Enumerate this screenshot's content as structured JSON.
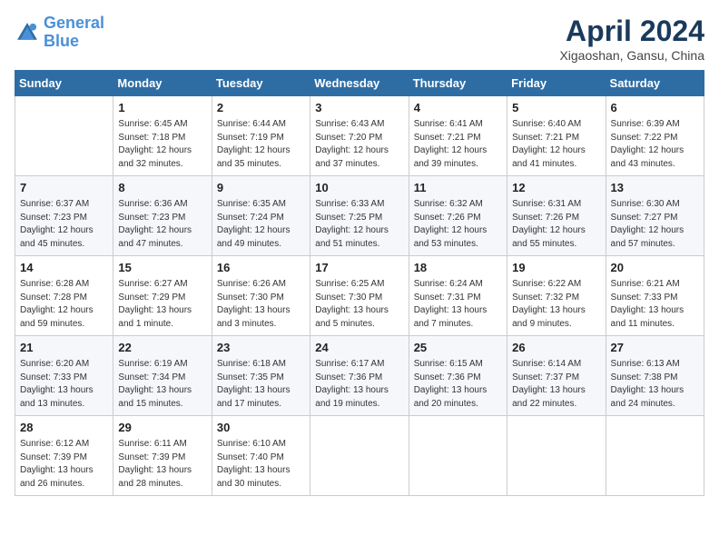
{
  "logo": {
    "line1": "General",
    "line2": "Blue"
  },
  "title": "April 2024",
  "location": "Xigaoshan, Gansu, China",
  "days_header": [
    "Sunday",
    "Monday",
    "Tuesday",
    "Wednesday",
    "Thursday",
    "Friday",
    "Saturday"
  ],
  "weeks": [
    [
      {
        "num": "",
        "sunrise": "",
        "sunset": "",
        "daylight": ""
      },
      {
        "num": "1",
        "sunrise": "Sunrise: 6:45 AM",
        "sunset": "Sunset: 7:18 PM",
        "daylight": "Daylight: 12 hours and 32 minutes."
      },
      {
        "num": "2",
        "sunrise": "Sunrise: 6:44 AM",
        "sunset": "Sunset: 7:19 PM",
        "daylight": "Daylight: 12 hours and 35 minutes."
      },
      {
        "num": "3",
        "sunrise": "Sunrise: 6:43 AM",
        "sunset": "Sunset: 7:20 PM",
        "daylight": "Daylight: 12 hours and 37 minutes."
      },
      {
        "num": "4",
        "sunrise": "Sunrise: 6:41 AM",
        "sunset": "Sunset: 7:21 PM",
        "daylight": "Daylight: 12 hours and 39 minutes."
      },
      {
        "num": "5",
        "sunrise": "Sunrise: 6:40 AM",
        "sunset": "Sunset: 7:21 PM",
        "daylight": "Daylight: 12 hours and 41 minutes."
      },
      {
        "num": "6",
        "sunrise": "Sunrise: 6:39 AM",
        "sunset": "Sunset: 7:22 PM",
        "daylight": "Daylight: 12 hours and 43 minutes."
      }
    ],
    [
      {
        "num": "7",
        "sunrise": "Sunrise: 6:37 AM",
        "sunset": "Sunset: 7:23 PM",
        "daylight": "Daylight: 12 hours and 45 minutes."
      },
      {
        "num": "8",
        "sunrise": "Sunrise: 6:36 AM",
        "sunset": "Sunset: 7:23 PM",
        "daylight": "Daylight: 12 hours and 47 minutes."
      },
      {
        "num": "9",
        "sunrise": "Sunrise: 6:35 AM",
        "sunset": "Sunset: 7:24 PM",
        "daylight": "Daylight: 12 hours and 49 minutes."
      },
      {
        "num": "10",
        "sunrise": "Sunrise: 6:33 AM",
        "sunset": "Sunset: 7:25 PM",
        "daylight": "Daylight: 12 hours and 51 minutes."
      },
      {
        "num": "11",
        "sunrise": "Sunrise: 6:32 AM",
        "sunset": "Sunset: 7:26 PM",
        "daylight": "Daylight: 12 hours and 53 minutes."
      },
      {
        "num": "12",
        "sunrise": "Sunrise: 6:31 AM",
        "sunset": "Sunset: 7:26 PM",
        "daylight": "Daylight: 12 hours and 55 minutes."
      },
      {
        "num": "13",
        "sunrise": "Sunrise: 6:30 AM",
        "sunset": "Sunset: 7:27 PM",
        "daylight": "Daylight: 12 hours and 57 minutes."
      }
    ],
    [
      {
        "num": "14",
        "sunrise": "Sunrise: 6:28 AM",
        "sunset": "Sunset: 7:28 PM",
        "daylight": "Daylight: 12 hours and 59 minutes."
      },
      {
        "num": "15",
        "sunrise": "Sunrise: 6:27 AM",
        "sunset": "Sunset: 7:29 PM",
        "daylight": "Daylight: 13 hours and 1 minute."
      },
      {
        "num": "16",
        "sunrise": "Sunrise: 6:26 AM",
        "sunset": "Sunset: 7:30 PM",
        "daylight": "Daylight: 13 hours and 3 minutes."
      },
      {
        "num": "17",
        "sunrise": "Sunrise: 6:25 AM",
        "sunset": "Sunset: 7:30 PM",
        "daylight": "Daylight: 13 hours and 5 minutes."
      },
      {
        "num": "18",
        "sunrise": "Sunrise: 6:24 AM",
        "sunset": "Sunset: 7:31 PM",
        "daylight": "Daylight: 13 hours and 7 minutes."
      },
      {
        "num": "19",
        "sunrise": "Sunrise: 6:22 AM",
        "sunset": "Sunset: 7:32 PM",
        "daylight": "Daylight: 13 hours and 9 minutes."
      },
      {
        "num": "20",
        "sunrise": "Sunrise: 6:21 AM",
        "sunset": "Sunset: 7:33 PM",
        "daylight": "Daylight: 13 hours and 11 minutes."
      }
    ],
    [
      {
        "num": "21",
        "sunrise": "Sunrise: 6:20 AM",
        "sunset": "Sunset: 7:33 PM",
        "daylight": "Daylight: 13 hours and 13 minutes."
      },
      {
        "num": "22",
        "sunrise": "Sunrise: 6:19 AM",
        "sunset": "Sunset: 7:34 PM",
        "daylight": "Daylight: 13 hours and 15 minutes."
      },
      {
        "num": "23",
        "sunrise": "Sunrise: 6:18 AM",
        "sunset": "Sunset: 7:35 PM",
        "daylight": "Daylight: 13 hours and 17 minutes."
      },
      {
        "num": "24",
        "sunrise": "Sunrise: 6:17 AM",
        "sunset": "Sunset: 7:36 PM",
        "daylight": "Daylight: 13 hours and 19 minutes."
      },
      {
        "num": "25",
        "sunrise": "Sunrise: 6:15 AM",
        "sunset": "Sunset: 7:36 PM",
        "daylight": "Daylight: 13 hours and 20 minutes."
      },
      {
        "num": "26",
        "sunrise": "Sunrise: 6:14 AM",
        "sunset": "Sunset: 7:37 PM",
        "daylight": "Daylight: 13 hours and 22 minutes."
      },
      {
        "num": "27",
        "sunrise": "Sunrise: 6:13 AM",
        "sunset": "Sunset: 7:38 PM",
        "daylight": "Daylight: 13 hours and 24 minutes."
      }
    ],
    [
      {
        "num": "28",
        "sunrise": "Sunrise: 6:12 AM",
        "sunset": "Sunset: 7:39 PM",
        "daylight": "Daylight: 13 hours and 26 minutes."
      },
      {
        "num": "29",
        "sunrise": "Sunrise: 6:11 AM",
        "sunset": "Sunset: 7:39 PM",
        "daylight": "Daylight: 13 hours and 28 minutes."
      },
      {
        "num": "30",
        "sunrise": "Sunrise: 6:10 AM",
        "sunset": "Sunset: 7:40 PM",
        "daylight": "Daylight: 13 hours and 30 minutes."
      },
      {
        "num": "",
        "sunrise": "",
        "sunset": "",
        "daylight": ""
      },
      {
        "num": "",
        "sunrise": "",
        "sunset": "",
        "daylight": ""
      },
      {
        "num": "",
        "sunrise": "",
        "sunset": "",
        "daylight": ""
      },
      {
        "num": "",
        "sunrise": "",
        "sunset": "",
        "daylight": ""
      }
    ]
  ]
}
